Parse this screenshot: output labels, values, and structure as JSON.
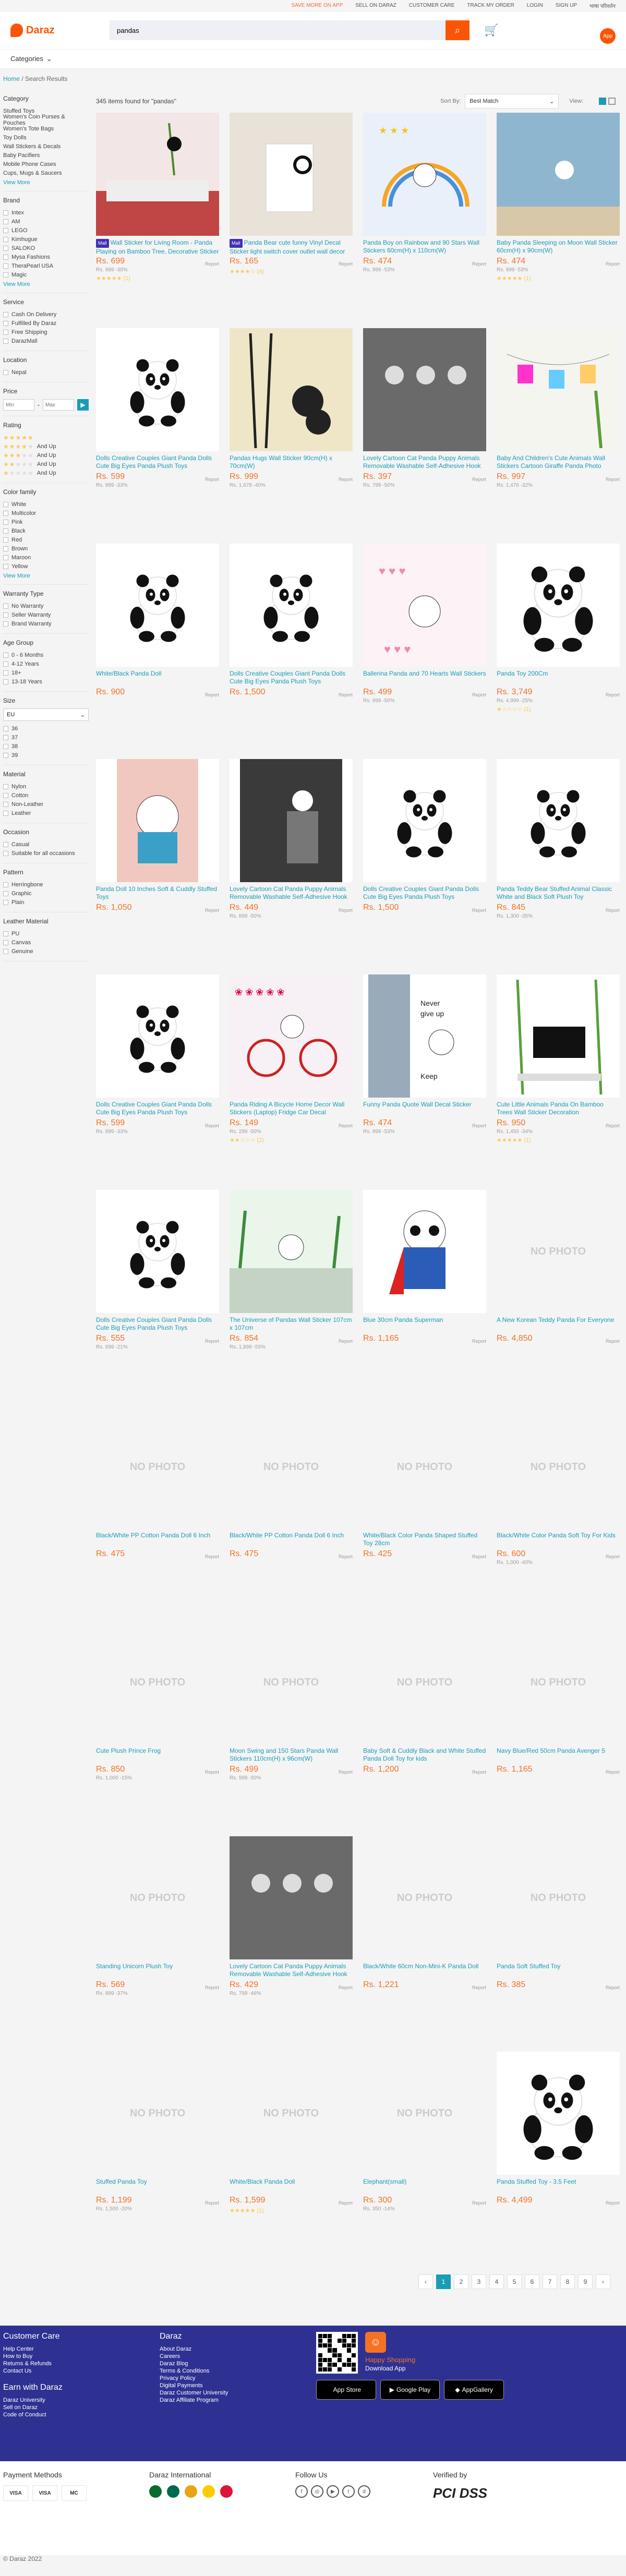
{
  "topbar": {
    "save_more": "SAVE MORE ON APP",
    "sell": "SELL ON DARAZ",
    "care": "CUSTOMER CARE",
    "track": "TRACK MY ORDER",
    "login": "LOGIN",
    "signup": "SIGN UP",
    "lang": "भाषा परिवर्तन"
  },
  "header": {
    "logo": "Daraz",
    "search_value": "pandas",
    "categories": "Categories"
  },
  "breadcrumb": {
    "home": "Home",
    "current": "Search Results"
  },
  "filters": {
    "category": {
      "title": "Category",
      "items": [
        "Stuffed Toys",
        "Women's Coin Purses & Pouches",
        "Women's Tote Bags",
        "Toy Dolls",
        "Wall Stickers & Decals",
        "Baby Pacifiers",
        "Mobile Phone Cases",
        "Cups, Mugs & Saucers"
      ],
      "more": "View More"
    },
    "brand": {
      "title": "Brand",
      "items": [
        "Intex",
        "AM",
        "LEGO",
        "Kimhugue",
        "SALOKO",
        "Mysa Fashions",
        "TheraPearl USA",
        "Magic"
      ],
      "more": "View More"
    },
    "service": {
      "title": "Service",
      "items": [
        "Cash On Delivery",
        "Fulfilled By Daraz",
        "Free Shipping",
        "DarazMall"
      ]
    },
    "location": {
      "title": "Location",
      "items": [
        "Nepal"
      ]
    },
    "price": {
      "title": "Price",
      "min": "Min",
      "max": "Max"
    },
    "rating": {
      "title": "Rating",
      "and_up": "And Up"
    },
    "color": {
      "title": "Color family",
      "items": [
        "White",
        "Multicolor",
        "Pink",
        "Black",
        "Red",
        "Brown",
        "Maroon",
        "Yellow"
      ],
      "more": "View More"
    },
    "warranty": {
      "title": "Warranty Type",
      "items": [
        "No Warranty",
        "Seller Warranty",
        "Brand Warranty"
      ]
    },
    "age": {
      "title": "Age Group",
      "items": [
        "0 - 6 Months",
        "4-12 Years",
        "18+",
        "13-18 Years"
      ]
    },
    "size": {
      "title": "Size",
      "selected": "EU",
      "items": [
        "36",
        "37",
        "38",
        "39"
      ]
    },
    "material": {
      "title": "Material",
      "items": [
        "Nylon",
        "Cotton",
        "Non-Leather",
        "Leather"
      ]
    },
    "occasion": {
      "title": "Occasion",
      "items": [
        "Casual",
        "Suitable for all occasions"
      ]
    },
    "pattern": {
      "title": "Pattern",
      "items": [
        "Herringbone",
        "Graphic",
        "Plain"
      ]
    },
    "leather": {
      "title": "Leather Material",
      "items": [
        "PU",
        "Canvas",
        "Genuine"
      ]
    }
  },
  "results": {
    "count": "345 items found for \"pandas\"",
    "sort_label": "Sort By:",
    "sort_value": "Best Match",
    "view_label": "View:"
  },
  "products": [
    {
      "title": "Wall Sticker for Living Room - Panda Playing on Bamboo Tree, Decorative Sticker",
      "price": "Rs. 699",
      "orig": "Rs. 999 -30%",
      "mall": true,
      "rating": "★★★★★ (1)",
      "img": "bedroom"
    },
    {
      "title": "Panda Bear cute funny Vinyl Decal Sticker light switch cover outlet wall decor",
      "price": "Rs. 165",
      "orig": "",
      "mall": true,
      "rating": "★★★★☆ (4)",
      "img": "switch"
    },
    {
      "title": "Panda Boy on Rainbow and 90 Stars Wall Stickers 60cm(H) x 110cm(W)",
      "price": "Rs. 474",
      "orig": "Rs. 999 -53%",
      "mall": false,
      "rating": "",
      "img": "rainbow"
    },
    {
      "title": "Baby Panda Sleeping on Moon Wall Sticker 60cm(H) x 90cm(W)",
      "price": "Rs. 474",
      "orig": "Rs. 999 -53%",
      "mall": false,
      "rating": "★★★★★ (1)",
      "img": "moon"
    },
    {
      "title": "Dolls Creative Couples Giant Panda Dolls Cute Big Eyes Panda Plush Toys",
      "price": "Rs. 599",
      "orig": "Rs. 899 -33%",
      "mall": false,
      "rating": "",
      "img": "plush"
    },
    {
      "title": "Pandas Hugs Wall Sticker 90cm(H) x 70cm(W)",
      "price": "Rs. 999",
      "orig": "Rs. 1,678 -40%",
      "mall": false,
      "rating": "",
      "img": "bamboo"
    },
    {
      "title": "Lovely Cartoon Cat Panda Puppy Animals Removable Washable Self-Adhesive Hook",
      "price": "Rs. 397",
      "orig": "Rs. 799 -50%",
      "mall": false,
      "rating": "",
      "img": "hooks"
    },
    {
      "title": "Baby And Children's Cute Animals Wall Stickers Cartoon Giraffe Panda Photo Frame",
      "price": "Rs. 997",
      "orig": "Rs. 1,476 -32%",
      "mall": false,
      "rating": "",
      "img": "frames"
    },
    {
      "title": "White/Black Panda Doll",
      "price": "Rs. 900",
      "orig": "",
      "mall": false,
      "rating": "",
      "img": "plush"
    },
    {
      "title": "Dolls Creative Couples Giant Panda Dolls Cute Big Eyes Panda Plush Toys",
      "price": "Rs. 1,500",
      "orig": "",
      "mall": false,
      "rating": "",
      "img": "plush"
    },
    {
      "title": "Ballerina Panda and 70 Hearts Wall Stickers",
      "price": "Rs. 499",
      "orig": "Rs. 999 -50%",
      "mall": false,
      "rating": "",
      "img": "hearts"
    },
    {
      "title": "Panda Toy 200Cm",
      "price": "Rs. 3,749",
      "orig": "Rs. 4,999 -25%",
      "mall": false,
      "rating": "★☆☆☆☆ (1)",
      "img": "bigplush"
    },
    {
      "title": "Panda Doll 10 Inches Soft & Cuddly Stuffed Toys",
      "price": "Rs. 1,050",
      "orig": "",
      "mall": false,
      "rating": "",
      "img": "pandadoll"
    },
    {
      "title": "Lovely Cartoon Cat Panda Puppy Animals Removable Washable Self-Adhesive Hook",
      "price": "Rs. 449",
      "orig": "Rs. 899 -50%",
      "mall": false,
      "rating": "",
      "img": "hook"
    },
    {
      "title": "Dolls Creative Couples Giant Panda Dolls Cute Big Eyes Panda Plush Toys",
      "price": "Rs. 1,500",
      "orig": "",
      "mall": false,
      "rating": "",
      "img": "plush"
    },
    {
      "title": "Panda Teddy Bear Stuffed Animal Classic White and Black Soft Plush Toy",
      "price": "Rs. 845",
      "orig": "Rs. 1,300 -35%",
      "mall": false,
      "rating": "",
      "img": "plush"
    },
    {
      "title": "Dolls Creative Couples Giant Panda Dolls Cute Big Eyes Panda Plush Toys",
      "price": "Rs. 599",
      "orig": "Rs. 899 -33%",
      "mall": false,
      "rating": "",
      "img": "plush"
    },
    {
      "title": "Panda Riding A Bicycle Home Decor Wall Stickers (Laptop) Fridge Car Decal",
      "price": "Rs. 149",
      "orig": "Rs. 299 -50%",
      "mall": false,
      "rating": "★★☆☆☆ (2)",
      "img": "bicycle"
    },
    {
      "title": "Funny Panda Quote Wall Decal Sticker",
      "price": "Rs. 474",
      "orig": "Rs. 999 -53%",
      "mall": false,
      "rating": "",
      "img": "quote"
    },
    {
      "title": "Cute Little Animals Panda On Bamboo Trees Wall Sticker Decoration",
      "price": "Rs. 950",
      "orig": "Rs. 1,450 -34%",
      "mall": false,
      "rating": "★★★★★ (1)",
      "img": "tvwall"
    },
    {
      "title": "Dolls Creative Couples Giant Panda Dolls Cute Big Eyes Panda Plush Toys",
      "price": "Rs. 555",
      "orig": "Rs. 699 -21%",
      "mall": false,
      "rating": "",
      "img": "plush"
    },
    {
      "title": "The Universe of Pandas Wall Sticker 107cm x 107cm",
      "price": "Rs. 854",
      "orig": "Rs. 1,899 -55%",
      "mall": false,
      "rating": "",
      "img": "universe"
    },
    {
      "title": "Blue 30cm Panda Superman",
      "price": "Rs. 1,165",
      "orig": "",
      "mall": false,
      "rating": "",
      "img": "superman"
    },
    {
      "title": "A New Korean Teddy Panda For Everyone",
      "price": "Rs. 4,850",
      "orig": "",
      "mall": false,
      "rating": "",
      "img": "none"
    },
    {
      "title": "Black/White PP Cotton Panda Doll 6 Inch",
      "price": "Rs. 475",
      "orig": "",
      "mall": false,
      "rating": "",
      "img": "none"
    },
    {
      "title": "Black/White PP Cotton Panda Doll 6 Inch",
      "price": "Rs. 475",
      "orig": "",
      "mall": false,
      "rating": "",
      "img": "none"
    },
    {
      "title": "White/Black Color Panda Shaped Stuffed Toy 28cm",
      "price": "Rs. 425",
      "orig": "",
      "mall": false,
      "rating": "",
      "img": "none"
    },
    {
      "title": "Black/White Color Panda Soft Toy For Kids",
      "price": "Rs. 600",
      "orig": "Rs. 1,000 -40%",
      "mall": false,
      "rating": "",
      "img": "none"
    },
    {
      "title": "Cute Plush Prince Frog",
      "price": "Rs. 850",
      "orig": "Rs. 1,000 -15%",
      "mall": false,
      "rating": "",
      "img": "none"
    },
    {
      "title": "Moon Swing and 150 Stars Panda Wall Stickers 110cm(H) x 96cm(W)",
      "price": "Rs. 499",
      "orig": "Rs. 999 -50%",
      "mall": false,
      "rating": "",
      "img": "none"
    },
    {
      "title": "Baby Soft & Cuddly Black and White Stuffed Panda Doll Toy for kids",
      "price": "Rs. 1,200",
      "orig": "",
      "mall": false,
      "rating": "",
      "img": "none"
    },
    {
      "title": "Navy Blue/Red 50cm Panda Avenger 5",
      "price": "Rs. 1,165",
      "orig": "",
      "mall": false,
      "rating": "",
      "img": "none"
    },
    {
      "title": "Standing Unicorn Plush Toy",
      "price": "Rs. 569",
      "orig": "Rs. 899 -37%",
      "mall": false,
      "rating": "",
      "img": "none"
    },
    {
      "title": "Lovely Cartoon Cat Panda Puppy Animals Removable Washable Self-Adhesive Hook",
      "price": "Rs. 429",
      "orig": "Rs. 799 -46%",
      "mall": false,
      "rating": "",
      "img": "hooks"
    },
    {
      "title": "Black/White 60cm Non-Mini-K Panda Doll",
      "price": "Rs. 1,221",
      "orig": "",
      "mall": false,
      "rating": "",
      "img": "none"
    },
    {
      "title": "Panda Soft Stuffed Toy",
      "price": "Rs. 385",
      "orig": "",
      "mall": false,
      "rating": "",
      "img": "none"
    },
    {
      "title": "Stuffed Panda Toy",
      "price": "Rs. 1,199",
      "orig": "Rs. 1,500 -20%",
      "mall": false,
      "rating": "",
      "img": "none"
    },
    {
      "title": "White/Black Panda Doll",
      "price": "Rs. 1,599",
      "orig": "",
      "mall": false,
      "rating": "★★★★★ (1)",
      "img": "none"
    },
    {
      "title": "Elephant(small)",
      "price": "Rs. 300",
      "orig": "Rs. 350 -14%",
      "mall": false,
      "rating": "",
      "img": "none"
    },
    {
      "title": "Panda Stuffed Toy - 3.5 Feet",
      "price": "Rs. 4,499",
      "orig": "",
      "mall": false,
      "rating": "",
      "img": "bigplush"
    }
  ],
  "labels": {
    "no_photo": "NO PHOTO",
    "report": "Report",
    "mall_tag": "Mall"
  },
  "pagination": [
    "‹",
    "1",
    "2",
    "3",
    "4",
    "5",
    "6",
    "7",
    "8",
    "9",
    "›"
  ],
  "footer": {
    "care_title": "Customer Care",
    "care_links": [
      "Help Center",
      "How to Buy",
      "Returns & Refunds",
      "Contact Us"
    ],
    "earn_title": "Earn with Daraz",
    "earn_links": [
      "Daraz University",
      "Sell on Daraz",
      "Code of Conduct"
    ],
    "daraz_title": "Daraz",
    "daraz_links": [
      "About Daraz",
      "Careers",
      "Daraz Blog",
      "Terms & Conditions",
      "Privacy Policy",
      "Digital Payments",
      "Daraz Customer University",
      "Daraz Affiliate Program"
    ],
    "happy": "Happy Shopping",
    "download": "Download App",
    "badges": [
      "App Store",
      "Google Play",
      "AppGallery"
    ]
  },
  "lower": {
    "payment": "Payment Methods",
    "pay_items": [
      "VISA",
      "VISA",
      "MC"
    ],
    "intl": "Daraz International",
    "follow": "Follow Us",
    "verified": "Verified by",
    "pci": "PCI DSS"
  },
  "copyright": "© Daraz 2022"
}
